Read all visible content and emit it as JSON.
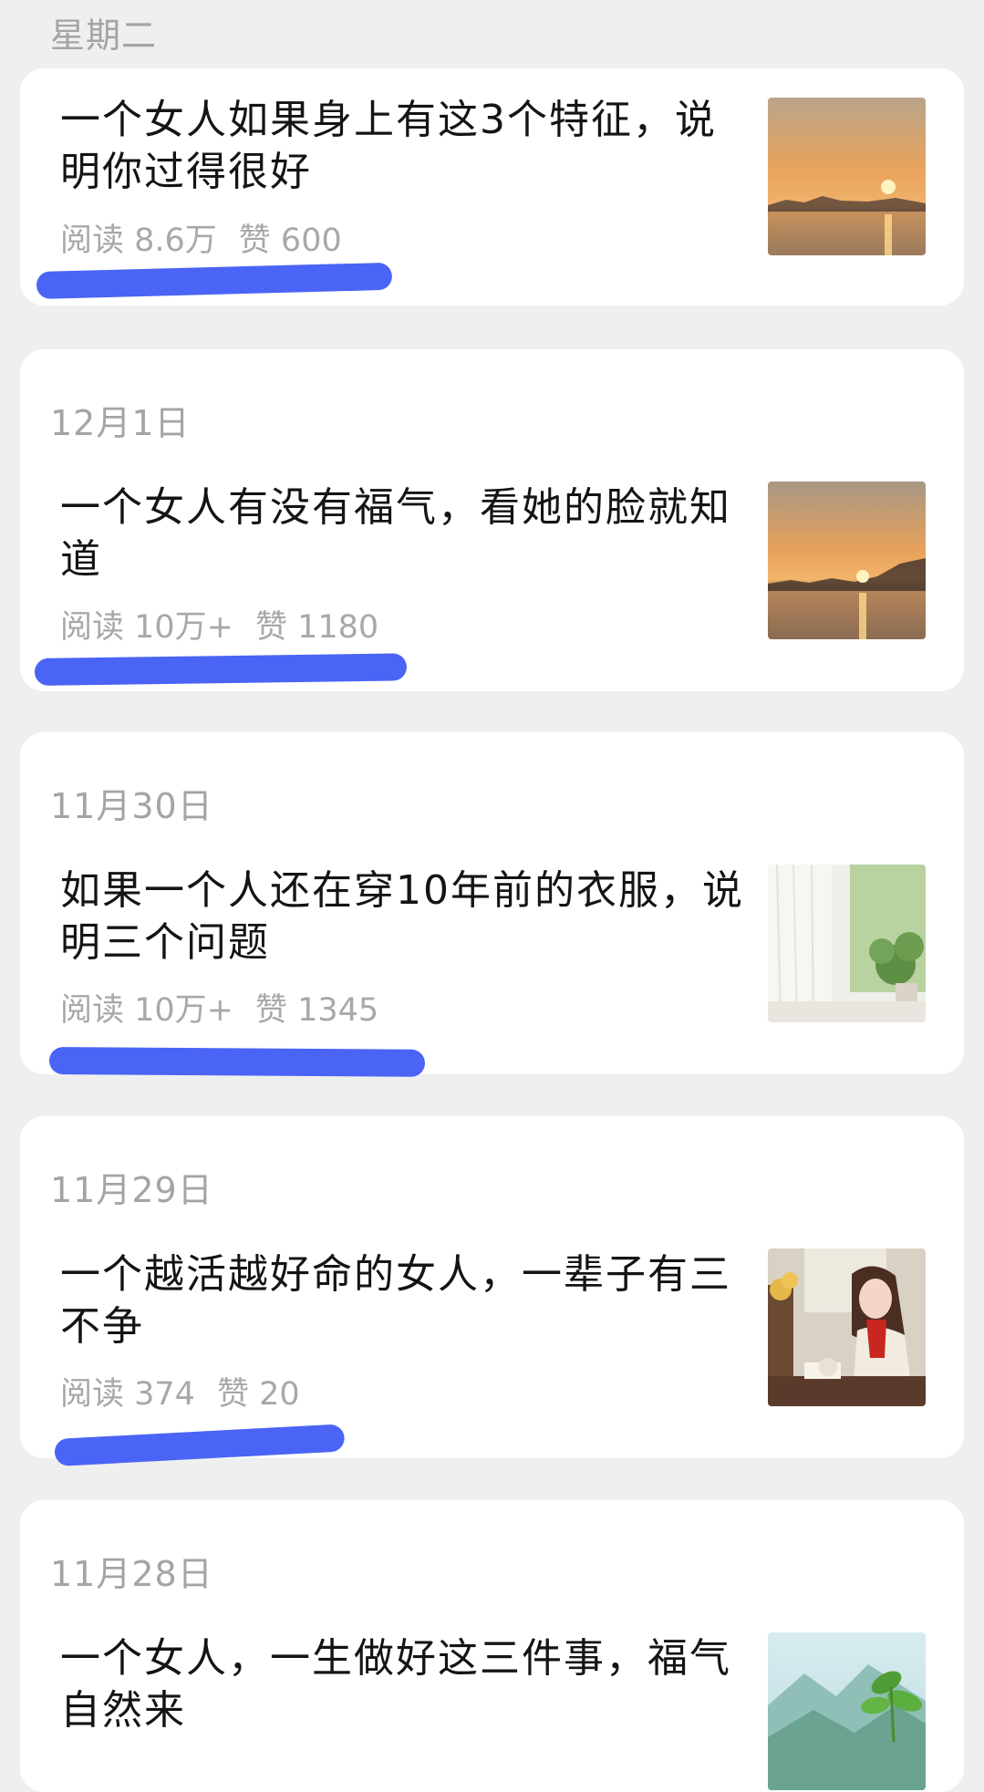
{
  "top_date": "星期二",
  "articles": [
    {
      "date": "",
      "title": "一个女人如果身上有这3个特征，说明你过得很好",
      "reads": "阅读 8.6万",
      "likes": "赞 600",
      "thumb": "sunset-image"
    },
    {
      "date": "12月1日",
      "title": "一个女人有没有福气，看她的脸就知道",
      "reads": "阅读 10万+",
      "likes": "赞 1180",
      "thumb": "sunset-image"
    },
    {
      "date": "11月30日",
      "title": "如果一个人还在穿10年前的衣服，说明三个问题",
      "reads": "阅读 10万+",
      "likes": "赞 1345",
      "thumb": "window-plant-image"
    },
    {
      "date": "11月29日",
      "title": "一个越活越好命的女人，一辈子有三不争",
      "reads": "阅读 374",
      "likes": "赞 20",
      "thumb": "woman-reading-image"
    },
    {
      "date": "11月28日",
      "title": "一个女人，一生做好这三件事，福气自然来",
      "reads": "",
      "likes": "",
      "thumb": "mountain-plant-image"
    }
  ],
  "colors": {
    "background": "#efefef",
    "card": "#ffffff",
    "title": "#141414",
    "meta": "#a8a8a8",
    "annotation": "#4a64f5"
  }
}
